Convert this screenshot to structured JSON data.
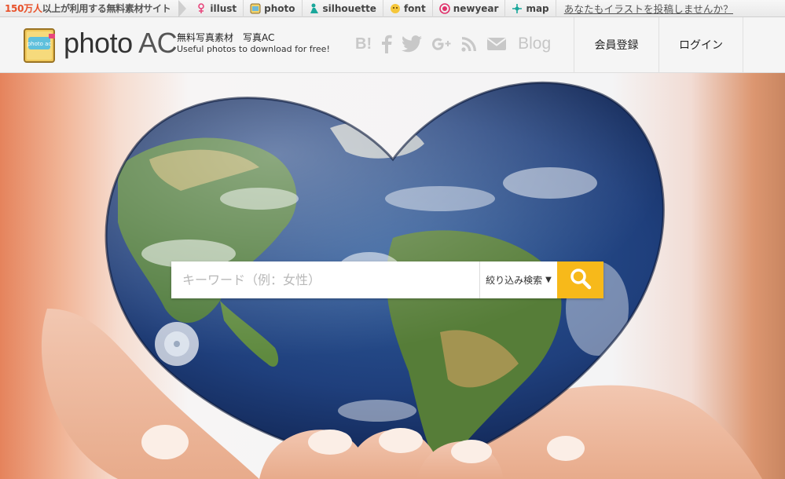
{
  "topbar": {
    "tagline_highlight": "150万人",
    "tagline_rest": "以上が利用する無料素材サイト",
    "services": [
      {
        "label": "illust",
        "icon": "illust-icon"
      },
      {
        "label": "photo",
        "icon": "photo-icon"
      },
      {
        "label": "silhouette",
        "icon": "silhouette-icon"
      },
      {
        "label": "font",
        "icon": "font-icon"
      },
      {
        "label": "newyear",
        "icon": "newyear-icon"
      },
      {
        "label": "map",
        "icon": "map-icon"
      }
    ],
    "post_link": "あなたもイラストを投稿しませんか？"
  },
  "header": {
    "logo_main": "photo",
    "logo_ac": "AC",
    "logo_badge": "photo ac",
    "subtitle_jp": "無料写真素材　写真AC",
    "subtitle_en": "Useful photos to download for free!",
    "social": {
      "hatena": "B!",
      "blog": "Blog"
    },
    "nav": {
      "register": "会員登録",
      "login": "ログイン"
    }
  },
  "search": {
    "placeholder": "キーワード（例：女性）",
    "value": "",
    "filter_label": "絞り込み検索",
    "filter_caret": "▼"
  },
  "colors": {
    "accent": "#f7b91a",
    "tagline_highlight": "#e8512a"
  }
}
